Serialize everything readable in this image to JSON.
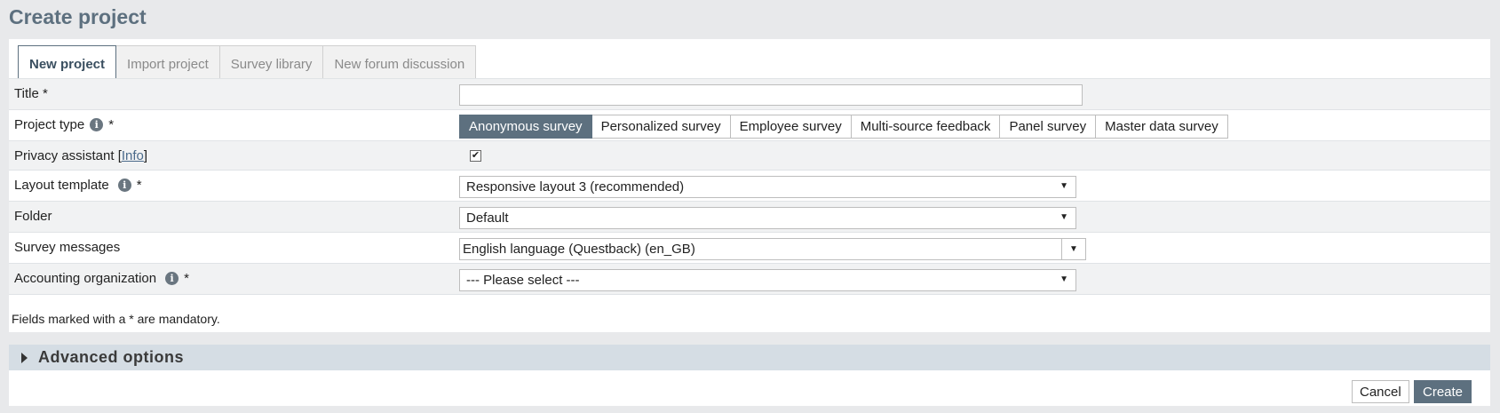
{
  "page": {
    "title": "Create project"
  },
  "tabs": [
    {
      "label": "New project",
      "active": true
    },
    {
      "label": "Import project"
    },
    {
      "label": "Survey library"
    },
    {
      "label": "New forum discussion"
    }
  ],
  "form": {
    "title": {
      "label": "Title *",
      "value": ""
    },
    "project_type": {
      "label": "Project type",
      "required_mark": "*",
      "options": [
        "Anonymous survey",
        "Personalized survey",
        "Employee survey",
        "Multi-source feedback",
        "Panel survey",
        "Master data survey"
      ],
      "selected": "Anonymous survey"
    },
    "privacy_assistant": {
      "label": "Privacy assistant [",
      "link": "Info",
      "label_end": "]",
      "checked": true,
      "check_glyph": "✔"
    },
    "layout_template": {
      "label": "Layout template",
      "required_mark": "*",
      "value": "Responsive layout 3 (recommended)"
    },
    "folder": {
      "label": "Folder",
      "value": "Default"
    },
    "survey_messages": {
      "label": "Survey messages",
      "value": "English language (Questback) (en_GB)"
    },
    "accounting_org": {
      "label": "Accounting organization",
      "required_mark": "*",
      "value": "--- Please select ---"
    },
    "mandatory_note": "Fields marked with a * are mandatory."
  },
  "advanced": {
    "label": "Advanced options"
  },
  "actions": {
    "cancel": "Cancel",
    "create": "Create"
  },
  "icons": {
    "info": "info-icon",
    "dropdown": "chevron-down-icon",
    "expand": "caret-right-icon"
  },
  "colors": {
    "accent": "#5d707f",
    "title": "#5d707f",
    "advanced_bar": "#d5dde4"
  }
}
